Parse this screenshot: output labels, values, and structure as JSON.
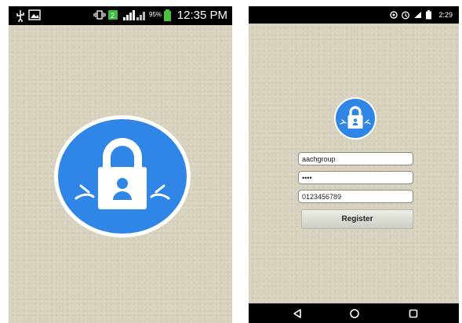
{
  "screen1": {
    "status": {
      "battery_pct": "95%",
      "time": "12:35 PM"
    },
    "logo": "padlock-logo"
  },
  "screen2": {
    "status": {
      "time": "2:29"
    },
    "logo": "padlock-logo",
    "form": {
      "username": "aachgroup",
      "password": "••••",
      "phone": "0123456789",
      "register_label": "Register"
    },
    "nav": [
      "back-icon",
      "home-icon",
      "recents-icon"
    ]
  },
  "colors": {
    "accent": "#2f86e6",
    "background": "#d8d2bf"
  }
}
